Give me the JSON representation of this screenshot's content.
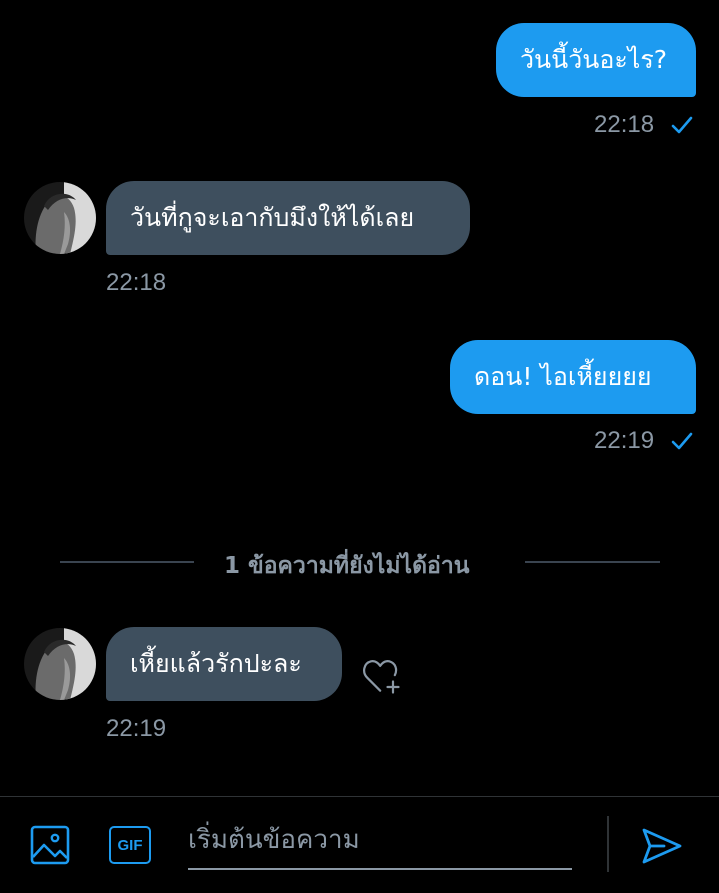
{
  "colors": {
    "accent": "#1d9bf0",
    "received_bubble": "#3e4f5e",
    "muted": "#8b98a5",
    "background": "#000000"
  },
  "messages": [
    {
      "direction": "sent",
      "text": "วันนี้วันอะไร?",
      "time": "22:18",
      "read_icon": "check-icon"
    },
    {
      "direction": "received",
      "text": "วันที่กูจะเอากับมึงให้ได้เลย",
      "time": "22:18",
      "avatar_icon": "avatar"
    },
    {
      "direction": "sent",
      "text": "ดอน! ไอเหี้ยยยย",
      "time": "22:19",
      "read_icon": "check-icon"
    },
    {
      "direction": "received",
      "text": "เหี้ยแล้วรักปะละ",
      "time": "22:19",
      "avatar_icon": "avatar",
      "reaction_icon": "heart-plus-icon"
    }
  ],
  "unread_divider": {
    "label": "1 ข้อความที่ยังไม่ได้อ่าน"
  },
  "composer": {
    "media_icon": "image-icon",
    "gif_label": "GIF",
    "placeholder": "เริ่มต้นข้อความ",
    "value": "",
    "send_icon": "send-icon"
  }
}
